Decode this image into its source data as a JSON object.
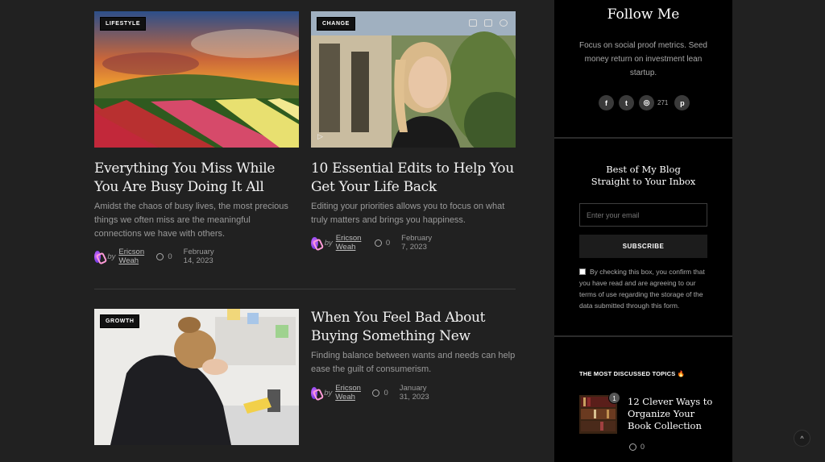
{
  "posts": [
    {
      "category": "LIFESTYLE",
      "title": "Everything You Miss While You Are Busy Doing It All",
      "excerpt": "Amidst the chaos of busy lives, the most precious things we often miss are the meaningful connections we have with others.",
      "by": "by",
      "author": "Ericson Weah",
      "comments": "0",
      "date": "February 14, 2023"
    },
    {
      "category": "CHANGE",
      "title": "10 Essential Edits to Help You Get Your Life Back",
      "excerpt": "Editing your priorities allows you to focus on what truly matters and brings you happiness.",
      "by": "by",
      "author": "Ericson Weah",
      "comments": "0",
      "date": "February 7, 2023"
    },
    {
      "category": "GROWTH",
      "title": "When You Feel Bad About Buying Something New",
      "excerpt": "Finding balance between wants and needs can help ease the guilt of consumerism.",
      "by": "by",
      "author": "Ericson Weah",
      "comments": "0",
      "date": "January 31, 2023"
    }
  ],
  "sidebar": {
    "follow": {
      "title": "Follow Me",
      "text": "Focus on social proof metrics. Seed money return on investment lean startup.",
      "socials": [
        {
          "icon": "facebook-icon",
          "glyph": "f"
        },
        {
          "icon": "twitter-icon",
          "glyph": "t"
        },
        {
          "icon": "instagram-icon",
          "glyph": "◎",
          "count": "271"
        },
        {
          "icon": "pinterest-icon",
          "glyph": "p"
        }
      ]
    },
    "newsletter": {
      "title_line1": "Best of My Blog",
      "title_line2": "Straight to Your Inbox",
      "email_placeholder": "Enter your email",
      "button": "SUBSCRIBE",
      "legal": "By checking this box, you confirm that you have read and are agreeing to our terms of use regarding the storage of the data submitted through this form."
    },
    "topics": {
      "title": "THE MOST DISCUSSED TOPICS 🔥",
      "items": [
        {
          "rank": "1",
          "title": "12 Clever Ways to Organize Your Book Collection",
          "comments": "0"
        }
      ]
    }
  },
  "scroll_top": "^"
}
